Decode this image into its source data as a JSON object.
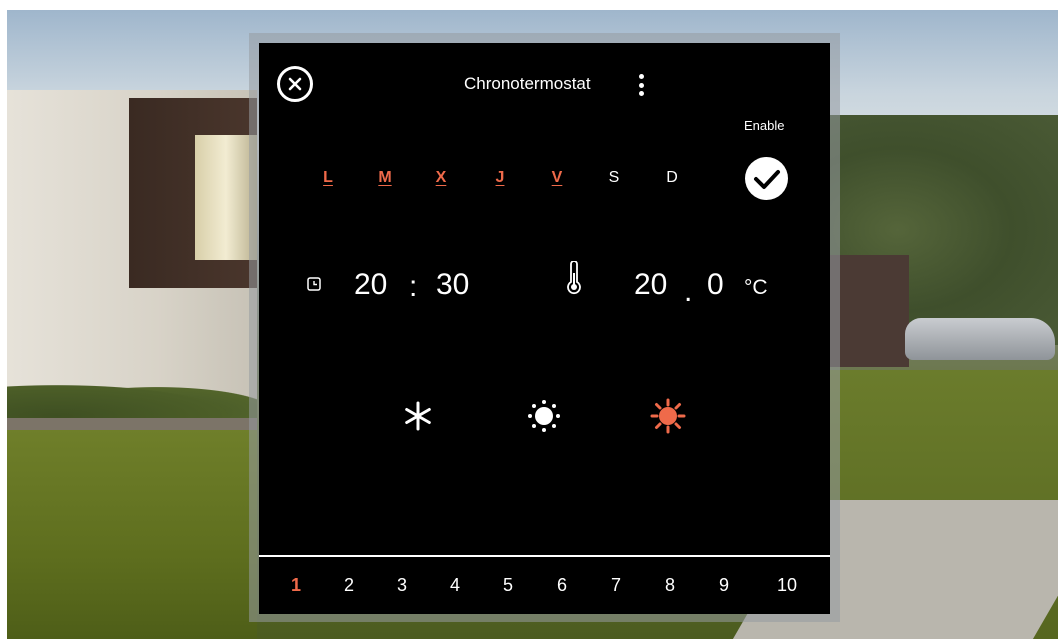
{
  "dialog": {
    "title": "Chronotermostat",
    "enable_label": "Enable",
    "enabled": true
  },
  "days": [
    {
      "label": "L",
      "active": true
    },
    {
      "label": "M",
      "active": true
    },
    {
      "label": "X",
      "active": true
    },
    {
      "label": "J",
      "active": true
    },
    {
      "label": "V",
      "active": true
    },
    {
      "label": "S",
      "active": false
    },
    {
      "label": "D",
      "active": false
    }
  ],
  "time": {
    "hours": "20",
    "separator": ":",
    "minutes": "30"
  },
  "temperature": {
    "integer": "20",
    "separator": ".",
    "decimal": "0",
    "unit": "°C"
  },
  "modes": [
    {
      "icon": "snowflake-icon",
      "selected": false
    },
    {
      "icon": "sun-icon",
      "selected": false
    },
    {
      "icon": "sun-hot-icon",
      "selected": true
    }
  ],
  "programs": [
    "1",
    "2",
    "3",
    "4",
    "5",
    "6",
    "7",
    "8",
    "9",
    "10"
  ],
  "active_program": "1",
  "colors": {
    "accent": "#ef6a4a",
    "dialog_bg": "#000000",
    "text": "#ffffff"
  }
}
